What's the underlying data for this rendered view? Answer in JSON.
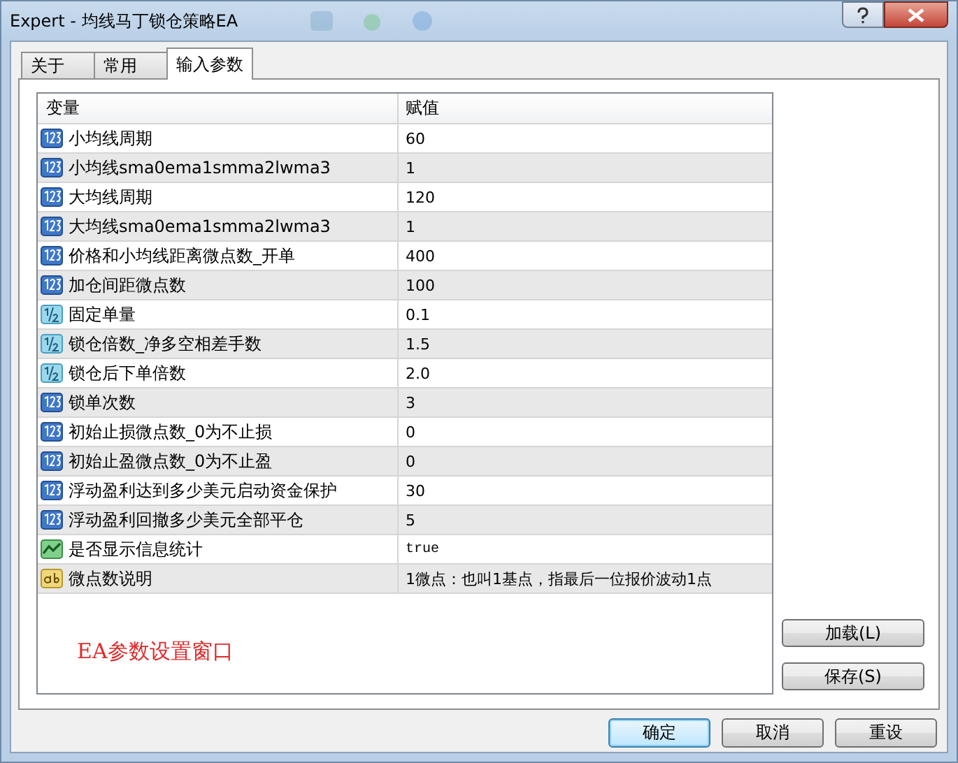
{
  "window": {
    "title": "Expert - 均线马丁锁仓策略EA"
  },
  "tabs": [
    {
      "label": "关于",
      "selected": false
    },
    {
      "label": "常用",
      "selected": false
    },
    {
      "label": "输入参数",
      "selected": true
    }
  ],
  "table": {
    "columns": [
      "变量",
      "赋值"
    ],
    "rows": [
      {
        "kind": "int",
        "name": "小均线周期",
        "value": "60"
      },
      {
        "kind": "int",
        "name": "小均线sma0ema1smma2lwma3",
        "value": "1"
      },
      {
        "kind": "int",
        "name": "大均线周期",
        "value": "120"
      },
      {
        "kind": "int",
        "name": "大均线sma0ema1smma2lwma3",
        "value": "1"
      },
      {
        "kind": "int",
        "name": "价格和小均线距离微点数_开单",
        "value": "400"
      },
      {
        "kind": "int",
        "name": "加仓间距微点数",
        "value": "100"
      },
      {
        "kind": "double",
        "name": "固定单量",
        "value": "0.1"
      },
      {
        "kind": "double",
        "name": "锁仓倍数_净多空相差手数",
        "value": "1.5"
      },
      {
        "kind": "double",
        "name": "锁仓后下单倍数",
        "value": "2.0"
      },
      {
        "kind": "int",
        "name": "锁单次数",
        "value": "3"
      },
      {
        "kind": "int",
        "name": "初始止损微点数_0为不止损",
        "value": "0"
      },
      {
        "kind": "int",
        "name": "初始止盈微点数_0为不止盈",
        "value": "0"
      },
      {
        "kind": "int",
        "name": "浮动盈利达到多少美元启动资金保护",
        "value": "30"
      },
      {
        "kind": "int",
        "name": "浮动盈利回撤多少美元全部平仓",
        "value": "5"
      },
      {
        "kind": "bool",
        "name": "是否显示信息统计",
        "value": "true"
      },
      {
        "kind": "string",
        "name": "微点数说明",
        "value": "1微点：也叫1基点，指最后一位报价波动1点"
      }
    ]
  },
  "annotation": "EA参数设置窗口",
  "side_buttons": [
    "加载(L)",
    "保存(S)"
  ],
  "buttons": [
    {
      "label": "确定",
      "default": true
    },
    {
      "label": "取消",
      "default": false
    },
    {
      "label": "重设",
      "default": false
    }
  ]
}
